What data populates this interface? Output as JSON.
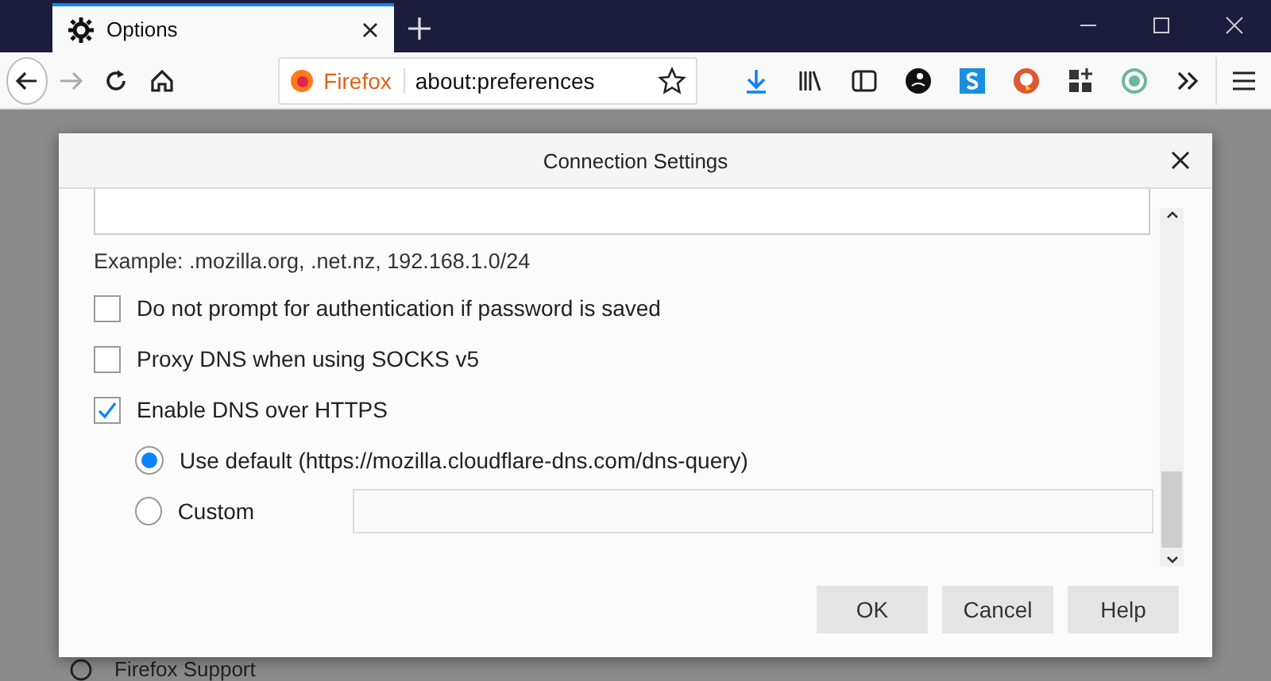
{
  "tabs": [
    {
      "label": "Options",
      "selected": true
    }
  ],
  "toolbar": {
    "identity_label": "Firefox",
    "url": "about:preferences"
  },
  "background": {
    "support_link": "Firefox Support"
  },
  "dialog": {
    "title": "Connection Settings",
    "example_hint": "Example: .mozilla.org, .net.nz, 192.168.1.0/24",
    "options": [
      {
        "kind": "checkbox",
        "label": "Do not prompt for authentication if password is saved",
        "checked": false
      },
      {
        "kind": "checkbox",
        "label": "Proxy DNS when using SOCKS v5",
        "checked": false
      },
      {
        "kind": "checkbox",
        "label": "Enable DNS over HTTPS",
        "checked": true
      },
      {
        "kind": "radio",
        "label": "Use default (https://mozilla.cloudflare-dns.com/dns-query)",
        "selected": true
      },
      {
        "kind": "radio_field",
        "label": "Custom",
        "selected": false
      }
    ],
    "buttons": [
      "OK",
      "Cancel",
      "Help"
    ]
  }
}
